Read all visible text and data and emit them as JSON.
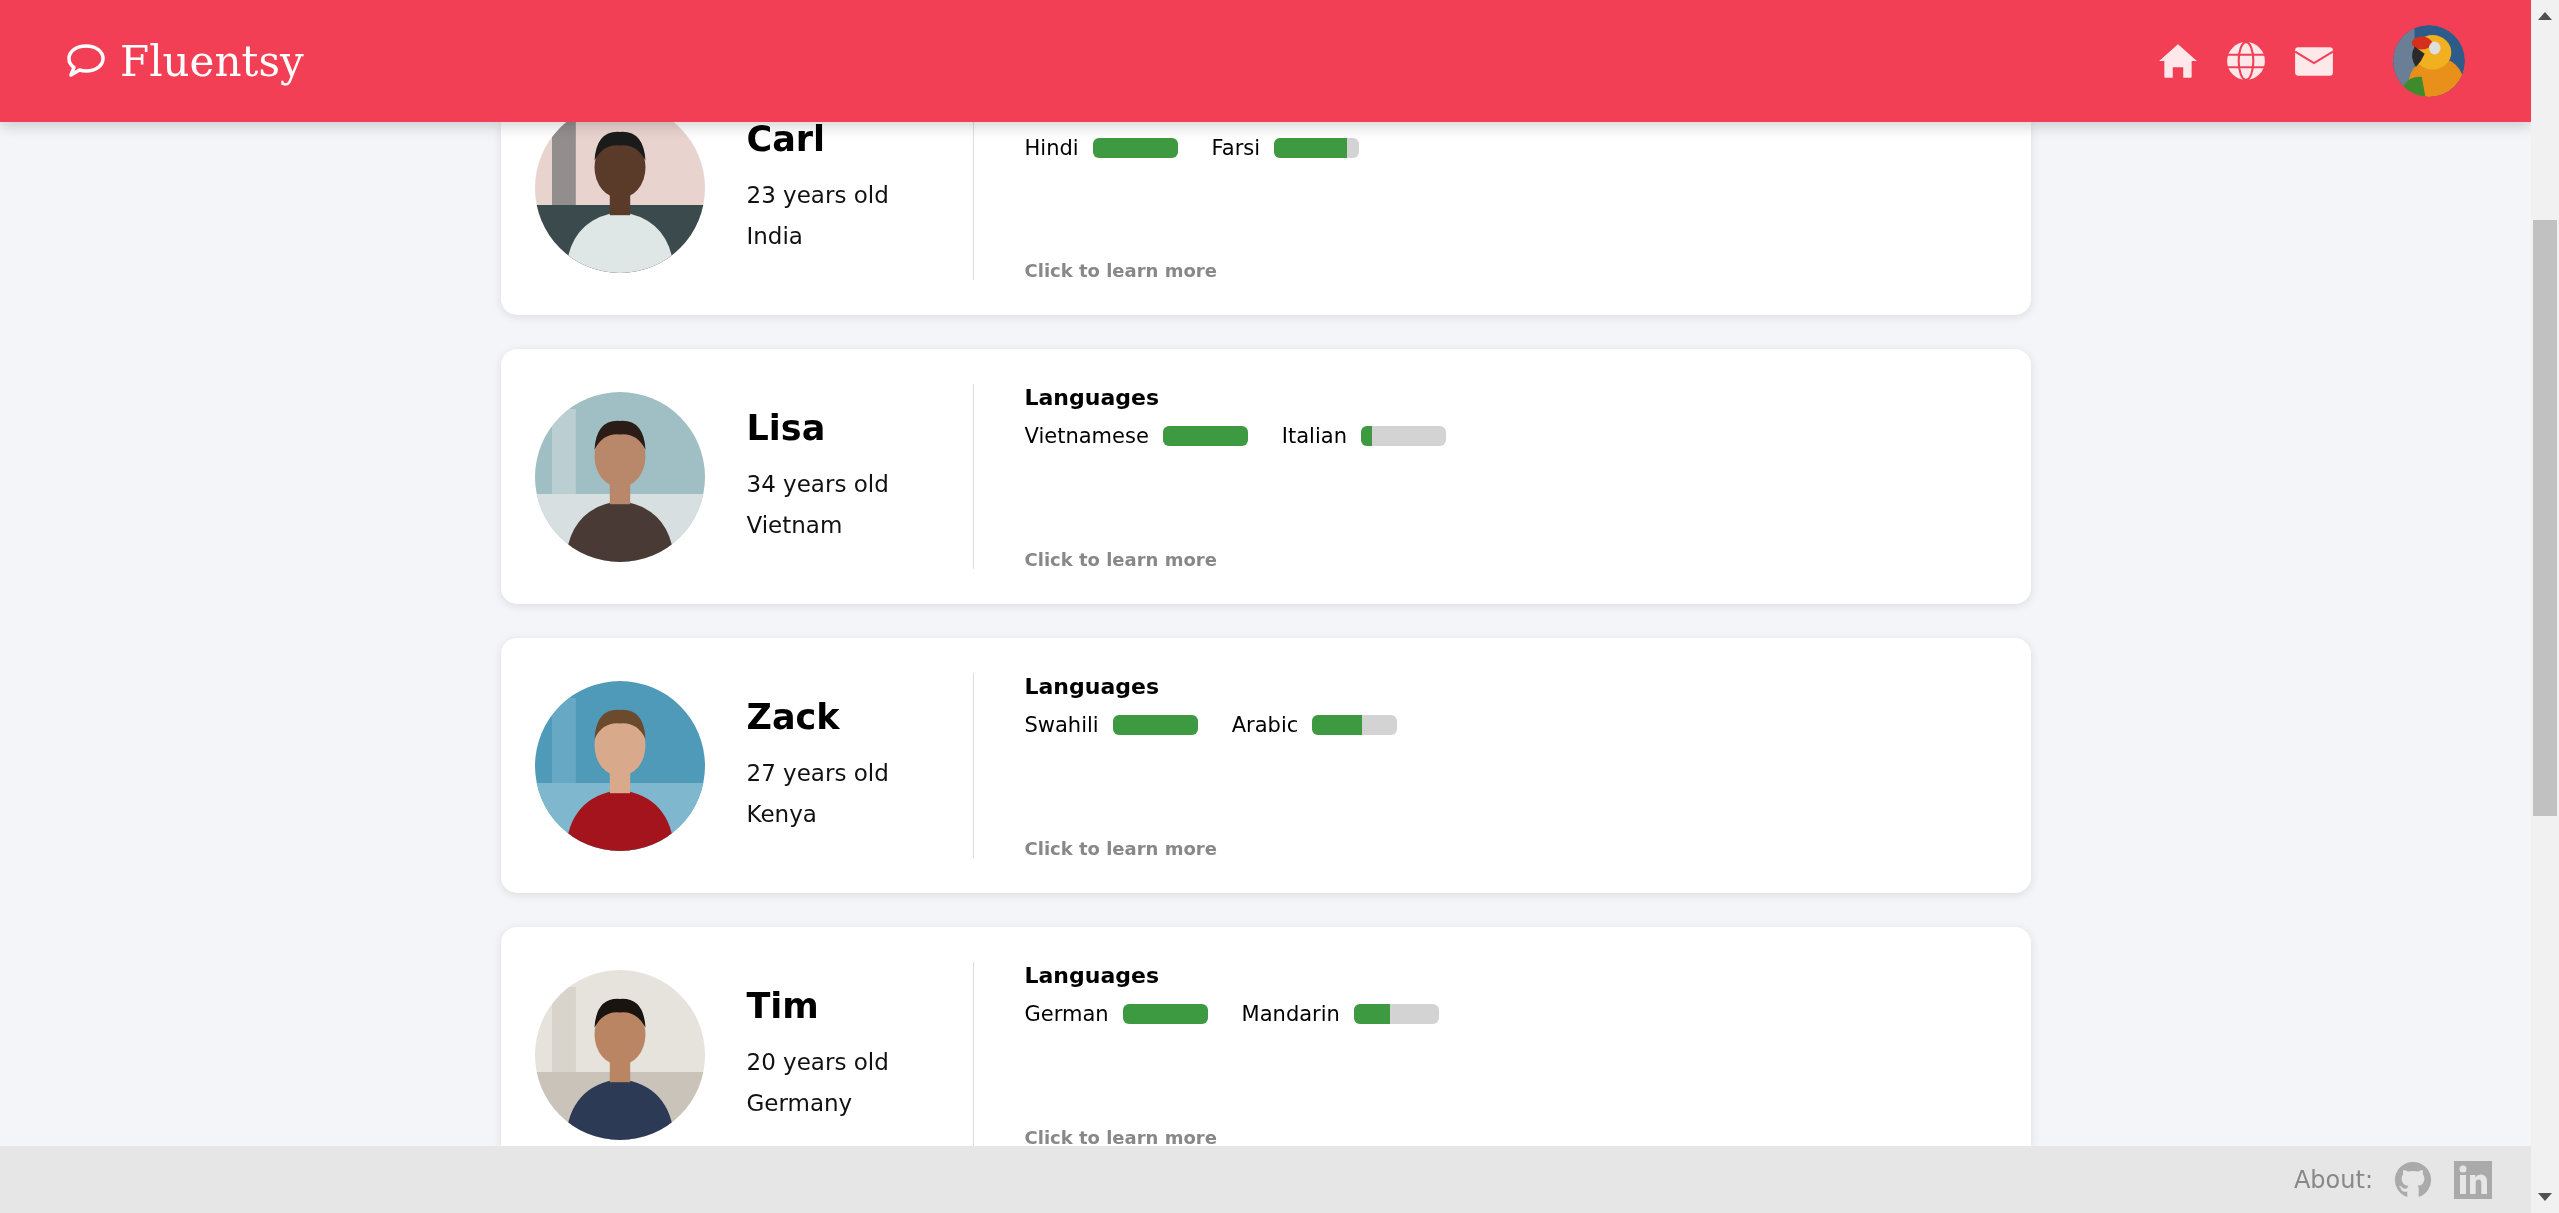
{
  "header": {
    "logo": "Fluentsy"
  },
  "profiles": [
    {
      "name": "Carl",
      "age": "23 years old",
      "country": "India",
      "languages": [
        {
          "name": "Hindi",
          "level": 1
        },
        {
          "name": "Farsi",
          "level": 0.86
        }
      ],
      "link": "Click to learn more"
    },
    {
      "name": "Lisa",
      "age": "34 years old",
      "country": "Vietnam",
      "languages_heading": "Languages",
      "languages": [
        {
          "name": "Vietnamese",
          "level": 1
        },
        {
          "name": "Italian",
          "level": 0.13
        }
      ],
      "link": "Click to learn more"
    },
    {
      "name": "Zack",
      "age": "27 years old",
      "country": "Kenya",
      "languages_heading": "Languages",
      "languages": [
        {
          "name": "Swahili",
          "level": 1
        },
        {
          "name": "Arabic",
          "level": 0.58
        }
      ],
      "link": "Click to learn more"
    },
    {
      "name": "Tim",
      "age": "20 years old",
      "country": "Germany",
      "languages_heading": "Languages",
      "languages": [
        {
          "name": "German",
          "level": 1
        },
        {
          "name": "Mandarin",
          "level": 0.42
        }
      ],
      "link": "Click to learn more"
    }
  ],
  "footer": {
    "label": "About:"
  }
}
